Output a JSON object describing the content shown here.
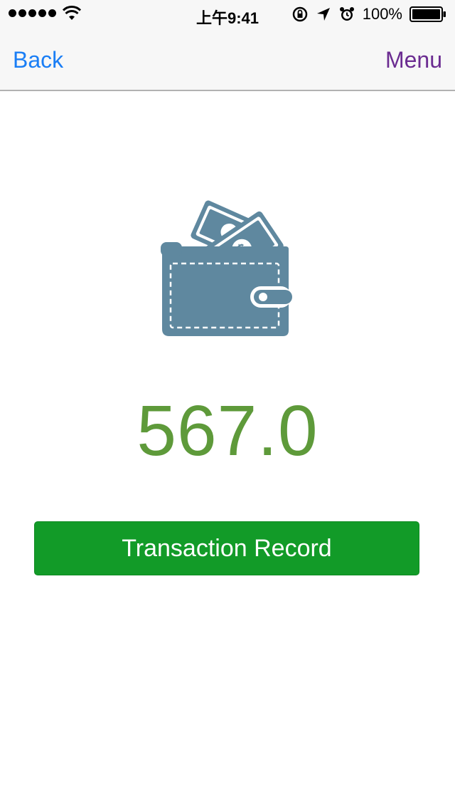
{
  "status_bar": {
    "time": "上午9:41",
    "battery_percent": "100%",
    "signal_bars": 5
  },
  "nav": {
    "back_label": "Back",
    "menu_label": "Menu"
  },
  "wallet": {
    "icon": "wallet-with-cash-icon",
    "balance": "567.0"
  },
  "actions": {
    "transaction_record_label": "Transaction Record"
  },
  "colors": {
    "back": "#1a7ef5",
    "menu": "#6b2c91",
    "balance": "#5e9a3a",
    "button": "#129b28",
    "wallet_icon": "#5f889f"
  }
}
